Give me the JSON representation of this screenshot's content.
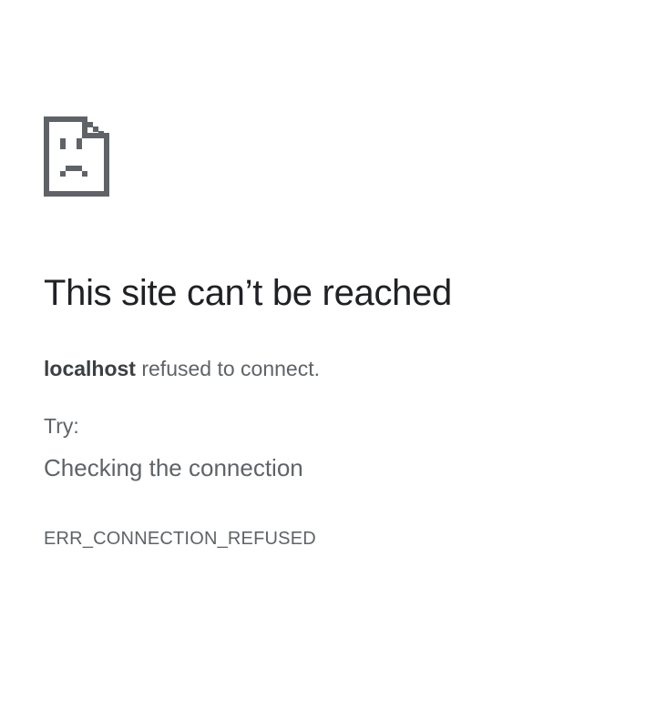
{
  "error_page": {
    "icon": "sad-document-icon",
    "title": "This site can’t be reached",
    "summary": {
      "host": "localhost",
      "message": " refused to connect."
    },
    "try_label": "Try:",
    "suggestions": [
      "Checking the connection"
    ],
    "error_code": "ERR_CONNECTION_REFUSED"
  },
  "colors": {
    "title": "#202124",
    "text": "#5f6368",
    "icon": "#5f6368",
    "background": "#ffffff"
  }
}
